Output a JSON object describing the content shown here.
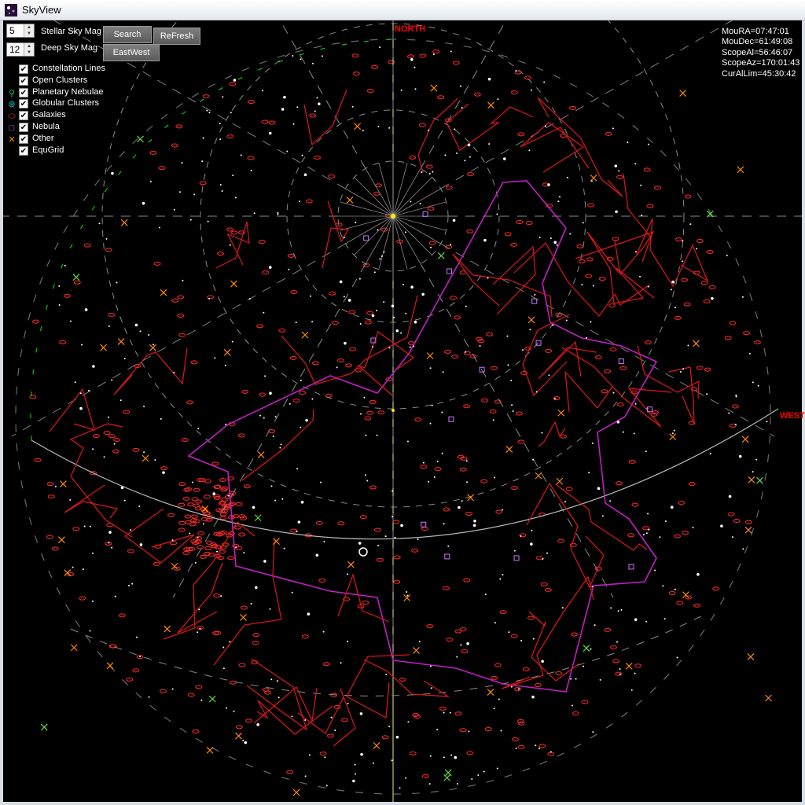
{
  "window": {
    "title": "SkyView"
  },
  "controls": {
    "stellar_mag": {
      "value": "5",
      "label": "Stellar Sky Mag"
    },
    "deep_mag": {
      "value": "12",
      "label": "Deep Sky Mag"
    },
    "search_label": "Search",
    "refresh_label": "ReFresh",
    "eastwest_label": "EastWest"
  },
  "legend": [
    {
      "label": "Constellation Lines",
      "symbol": "",
      "color": "#ff3333",
      "checked": true
    },
    {
      "label": "Open Clusters",
      "symbol": "",
      "color": "#00cc00",
      "checked": true
    },
    {
      "label": "Planetary Nebulae",
      "symbol": "planetary-icon",
      "color": "#00cc66",
      "checked": true
    },
    {
      "label": "Globular Clusters",
      "symbol": "globular-icon",
      "color": "#00cccc",
      "checked": true
    },
    {
      "label": "Galaxies",
      "symbol": "galaxy-icon",
      "color": "#ff2020",
      "checked": true
    },
    {
      "label": "Nebula",
      "symbol": "nebula-icon",
      "color": "#cc66ff",
      "checked": true
    },
    {
      "label": "Other",
      "symbol": "other-icon",
      "color": "#ff8800",
      "checked": true
    },
    {
      "label": "EquGrid",
      "symbol": "",
      "color": "#888888",
      "checked": true
    }
  ],
  "status": [
    "MouRA=07:47:01",
    "MouDec=61:49:08",
    "ScopeAl=56:46:07",
    "ScopeAz=170:01:43",
    "CurAlLim=45:30:42"
  ],
  "directions": {
    "north": "NORTH",
    "west": "WEST"
  },
  "colors": {
    "constellation": "#e01818",
    "galaxy": "#ff2a2a",
    "grid": "#8a8a8a",
    "horizon": "#00cc00",
    "milkyway": "#c020c0",
    "meridian": "#e6e68a",
    "star": "#ffffff",
    "nebula": "#cc77ff",
    "other": "#ff8800"
  }
}
